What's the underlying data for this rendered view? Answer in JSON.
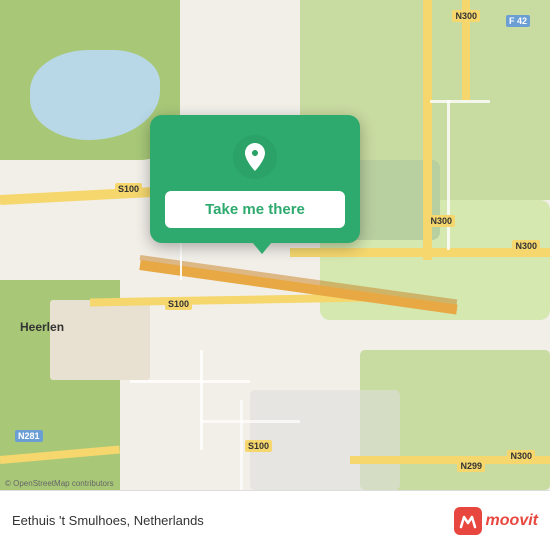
{
  "map": {
    "attribution": "© OpenStreetMap contributors",
    "center_label": "Eethuis 't Smulhoes, Netherlands"
  },
  "popup": {
    "button_label": "Take me there"
  },
  "footer": {
    "place_name": "Eethuis 't Smulhoes, Netherlands",
    "logo_text": "moovit"
  },
  "road_labels": {
    "s100_left": "S100",
    "s100_mid": "S100",
    "s100_bottom": "S100",
    "n300_top_right": "N300",
    "n300_right": "N300",
    "n300_bottom_right": "N300",
    "n281": "N281",
    "n299": "N299",
    "f42": "F 42"
  }
}
